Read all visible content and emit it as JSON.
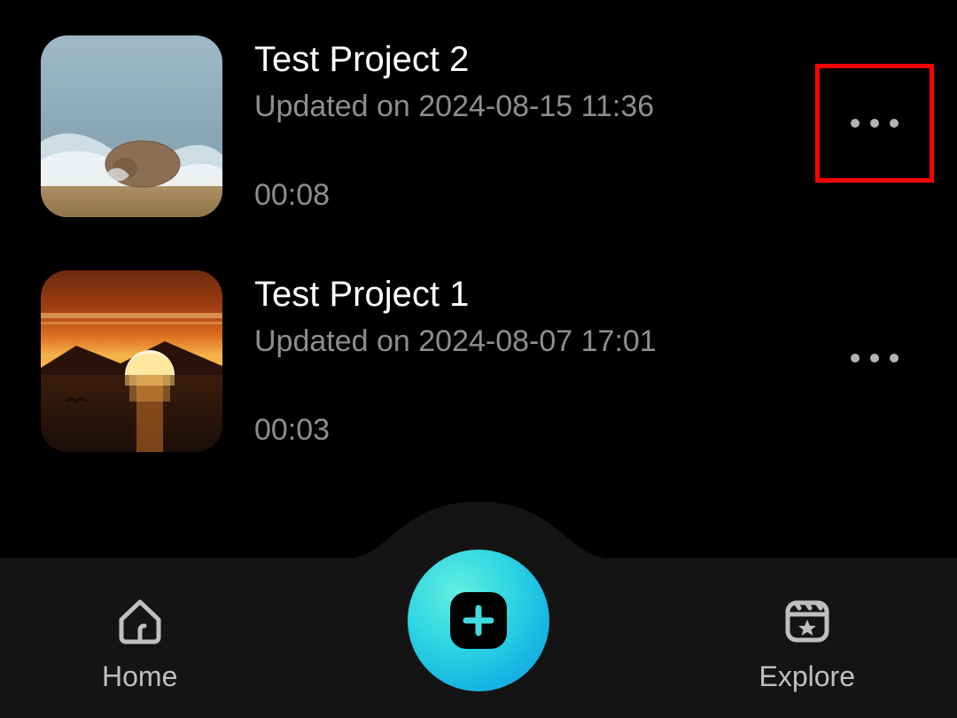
{
  "projects": [
    {
      "title": "Test Project 2",
      "updated": "Updated on 2024-08-15 11:36",
      "duration": "00:08",
      "thumb": "walrus-water",
      "highlighted": true
    },
    {
      "title": "Test Project 1",
      "updated": "Updated on 2024-08-07 17:01",
      "duration": "00:03",
      "thumb": "sunset-sea",
      "highlighted": false
    }
  ],
  "nav": {
    "home": "Home",
    "explore": "Explore"
  }
}
